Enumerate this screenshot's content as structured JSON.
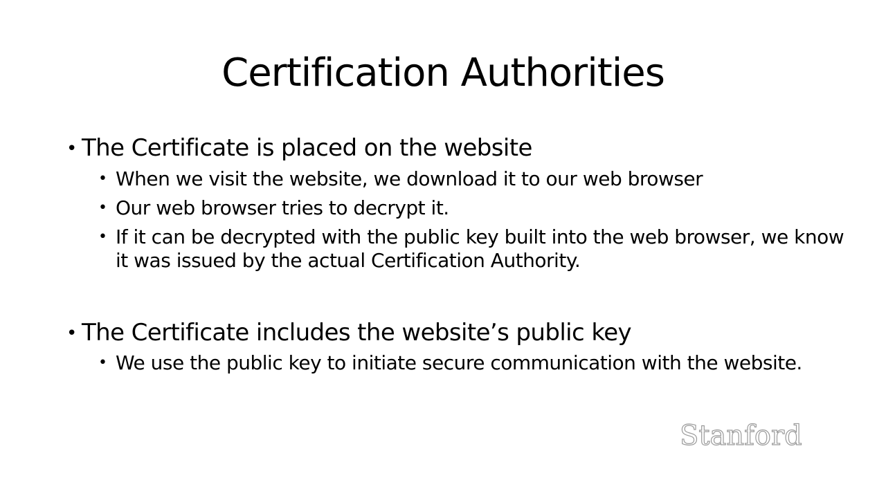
{
  "slide": {
    "title": "Certification Authorities",
    "bullets": [
      {
        "text": "The Certificate is placed on the website",
        "sub": [
          "When we visit the website, we download it to our web browser",
          "Our web browser tries to decrypt it.",
          "If it can be decrypted with the public key built into the web browser, we know it was issued by the actual Certification Authority."
        ]
      },
      {
        "text": "The Certificate includes the website’s public key",
        "sub": [
          "We use the public key to initiate secure communication with the website."
        ]
      }
    ],
    "bullet_glyph": "•",
    "logo": "Stanford"
  },
  "colors": {
    "background": "#ffffff",
    "text": "#000000",
    "logo_outline": "#9a9a9a"
  }
}
